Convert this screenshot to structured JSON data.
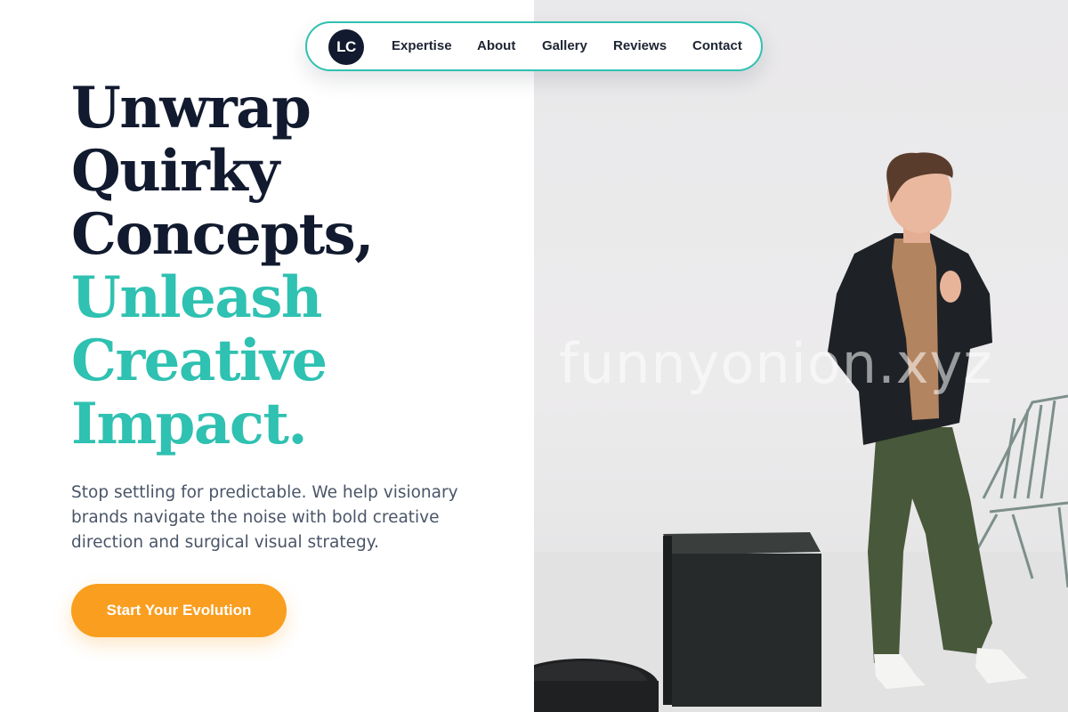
{
  "nav": {
    "logo_text": "LC",
    "links": [
      "Expertise",
      "About",
      "Gallery",
      "Reviews",
      "Contact"
    ]
  },
  "hero": {
    "headline_dark": [
      "Unwrap",
      "Quirky",
      "Concepts,"
    ],
    "headline_accent": [
      "Unleash",
      "Creative",
      "Impact."
    ],
    "subtext": "Stop settling for predictable. We help visionary brands navigate the noise with bold creative direction and surgical visual strategy.",
    "cta_label": "Start Your Evolution"
  },
  "image": {
    "watermark": "funnyonion.xyz"
  },
  "colors": {
    "accent": "#2fc1b1",
    "dark": "#111a2e",
    "cta": "#f99e1f",
    "body_text": "#4a5568"
  }
}
